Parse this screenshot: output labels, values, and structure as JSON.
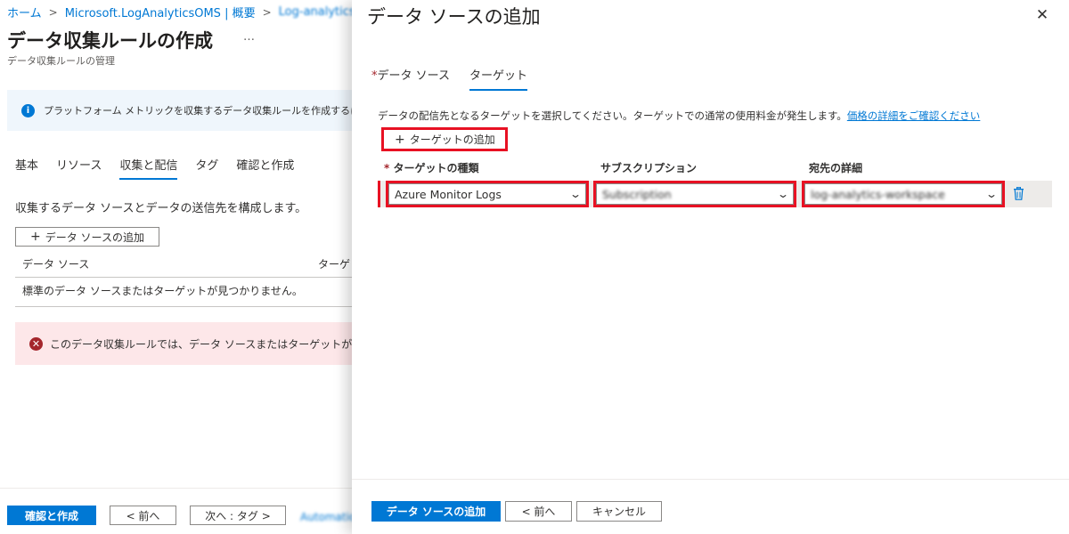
{
  "breadcrumb": [
    {
      "label": "ホーム"
    },
    {
      "label": "Microsoft.LogAnalyticsOMS | 概要"
    },
    {
      "label": "Log-analytics-w"
    }
  ],
  "left_page": {
    "title": "データ収集ルールの作成",
    "more_label": "…",
    "subtitle": "データ収集ルールの管理",
    "info_text": "プラットフォーム メトリックを収集するデータ収集ルールを作成するには、こ",
    "tabs": [
      {
        "label": "基本"
      },
      {
        "label": "リソース"
      },
      {
        "label": "収集と配信"
      },
      {
        "label": "タグ"
      },
      {
        "label": "確認と作成"
      }
    ],
    "section_desc": "収集するデータ ソースとデータの送信先を構成します。",
    "add_source_label": "データ ソースの追加",
    "table_headers": {
      "source": "データ ソース",
      "target": "ターゲット"
    },
    "empty_message": "標準のデータ ソースまたはターゲットが見つかりません。",
    "error_text": "このデータ収集ルールでは、データ ソースまたはターゲットが選択されて",
    "footer": {
      "review_create": "確認と作成",
      "previous": "< 前へ",
      "next": "次へ : タグ >",
      "download": "Automation のテンプレートをダウンロードする"
    }
  },
  "panel": {
    "title": "データ ソースの追加",
    "tabs": [
      {
        "label": "データ ソース",
        "required": "*"
      },
      {
        "label": "ターゲット"
      }
    ],
    "description": "データの配信先となるターゲットを選択してください。ターゲットでの通常の使用料金が発生します。",
    "description_link": "価格の詳細をご確認ください",
    "add_target_label": "ターゲットの追加",
    "columns": {
      "target_type_required": "*",
      "target_type": "ターゲットの種類",
      "subscription": "サブスクリプション",
      "destination": "宛先の詳細"
    },
    "row": {
      "target_type_value": "Azure Monitor Logs",
      "subscription_value": "Subscription",
      "destination_value": "log-analytics-workspace"
    },
    "footer": {
      "add_source": "データ ソースの追加",
      "previous": "< 前へ",
      "cancel": "キャンセル"
    }
  },
  "icons": {
    "info": "info-icon",
    "error": "error-icon",
    "close": "close-icon",
    "plus": "plus-icon",
    "chevron": "chevron-down-icon",
    "trash": "trash-icon"
  },
  "colors": {
    "accent": "#0078d4",
    "highlight_red": "#e81123",
    "error_bg": "#fde7e9",
    "info_bg": "#eff6fc"
  }
}
